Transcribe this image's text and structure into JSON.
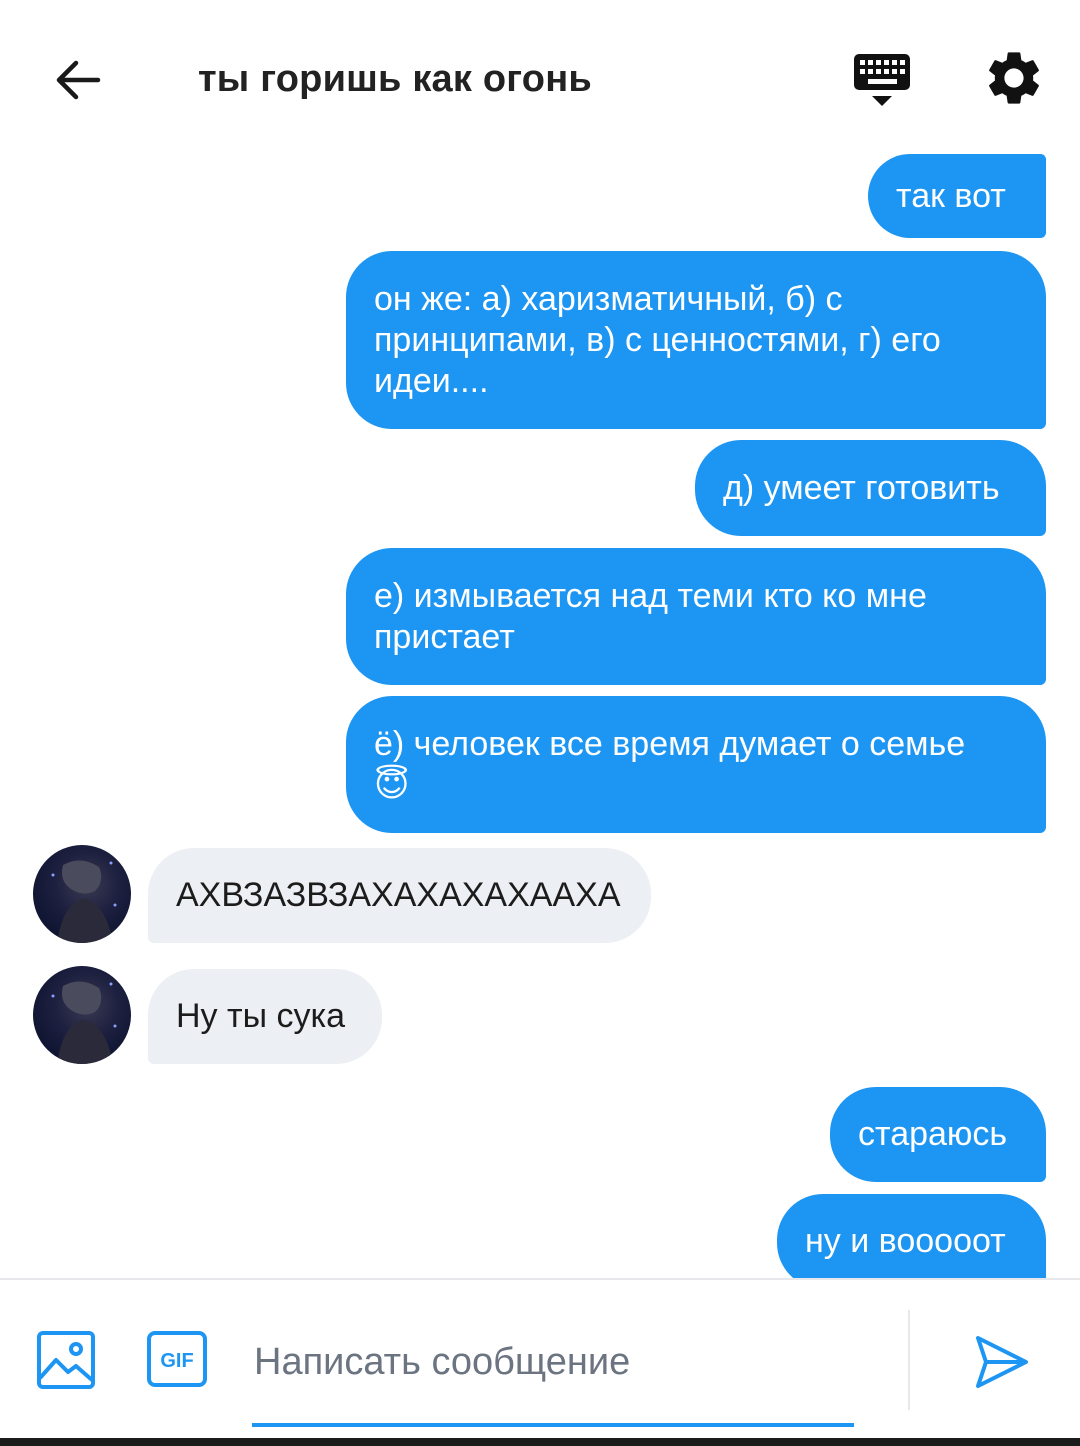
{
  "header": {
    "title": "ты горишь как огонь",
    "back_icon": "arrow-left-icon",
    "keyboard_icon": "keyboard-icon",
    "settings_icon": "gear-icon"
  },
  "messages": [
    {
      "direction": "outgoing",
      "text": "так вот"
    },
    {
      "direction": "outgoing",
      "text": "он же: а) харизматичный, б) с принципами, в) с ценностями, г) его идеи...."
    },
    {
      "direction": "outgoing",
      "text": "д) умеет готовить"
    },
    {
      "direction": "outgoing",
      "text": "е) измывается над теми кто ко мне пристает"
    },
    {
      "direction": "outgoing",
      "text": "ё) человек все время думает о семье 😇"
    },
    {
      "direction": "incoming",
      "text": "АХВЗАЗВЗАХАХАХАХААХА"
    },
    {
      "direction": "incoming",
      "text": "Ну ты сука"
    },
    {
      "direction": "outgoing",
      "text": "стараюсь"
    },
    {
      "direction": "outgoing",
      "text": "ну и вооооот"
    }
  ],
  "composer": {
    "placeholder": "Написать сообщение",
    "value": "",
    "image_icon": "image-icon",
    "gif_label": "GIF",
    "send_icon": "send-icon"
  },
  "colors": {
    "accent": "#1d95f2",
    "incoming_bubble": "#eceff3",
    "outgoing_text": "#ffffff"
  }
}
